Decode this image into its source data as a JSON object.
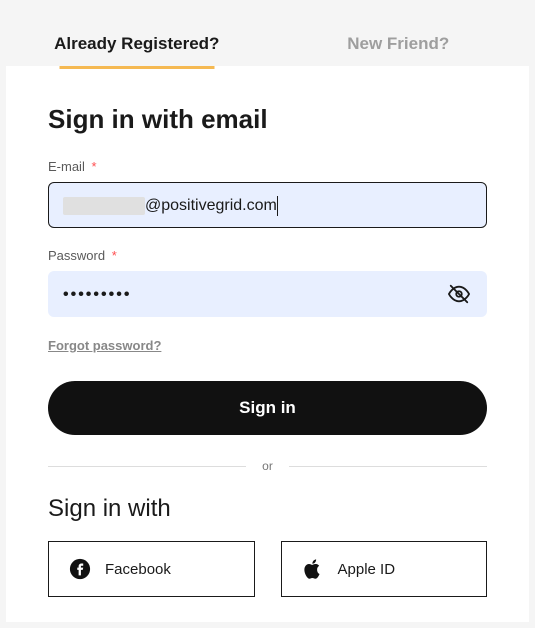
{
  "tabs": {
    "registered": "Already Registered?",
    "new_friend": "New Friend?"
  },
  "heading": "Sign in with email",
  "email": {
    "label": "E-mail",
    "required_marker": "*",
    "value_suffix": "@positivegrid.com"
  },
  "password": {
    "label": "Password",
    "required_marker": "*",
    "masked_value": "•••••••••"
  },
  "forgot": "Forgot password?",
  "signin_button": "Sign in",
  "divider": "or",
  "social_heading": "Sign in with",
  "social": {
    "facebook": "Facebook",
    "apple": "Apple ID"
  }
}
